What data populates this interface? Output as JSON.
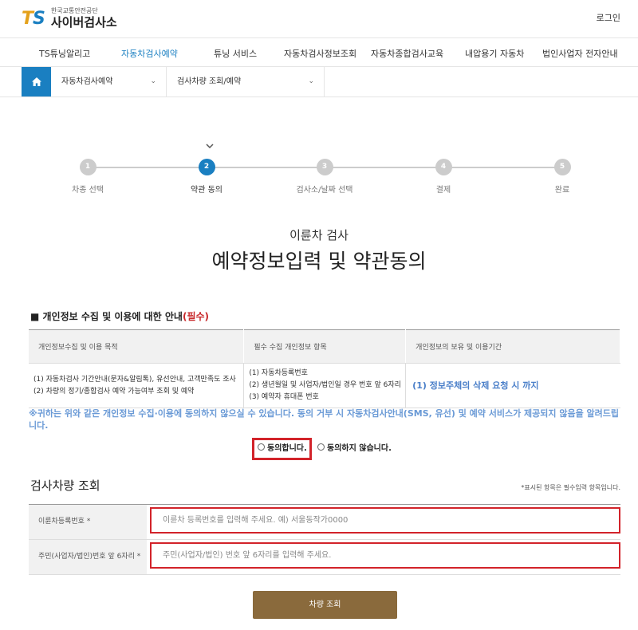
{
  "header": {
    "logo_mark_t": "T",
    "logo_mark_s": "S",
    "logo_small": "한국교통안전공단",
    "logo_big": "사이버검사소",
    "login": "로그인"
  },
  "gnb": [
    {
      "label": "TS튜닝알리고",
      "active": false
    },
    {
      "label": "자동차검사예약",
      "active": true
    },
    {
      "label": "튜닝 서비스",
      "active": false
    },
    {
      "label": "자동차검사정보조회",
      "active": false
    },
    {
      "label": "자동차종합검사교육",
      "active": false
    },
    {
      "label": "내압용기 자동차",
      "active": false
    },
    {
      "label": "법인사업자 전자안내",
      "active": false
    }
  ],
  "breadcrumb": {
    "level1": "자동차검사예약",
    "level2": "검사차량 조회/예약"
  },
  "steps": [
    {
      "num": "1",
      "label": "차종 선택"
    },
    {
      "num": "2",
      "label": "약관 동의"
    },
    {
      "num": "3",
      "label": "검사소/날짜 선택"
    },
    {
      "num": "4",
      "label": "결제"
    },
    {
      "num": "5",
      "label": "완료"
    }
  ],
  "active_step": 2,
  "page": {
    "subtitle": "이륜차 검사",
    "title": "예약정보입력 및 약관동의"
  },
  "privacy": {
    "title_main": "■ 개인정보 수집 및 이용에 대한 안내",
    "title_req": "(필수)",
    "headers": [
      "개인정보수집 및 이용 목적",
      "필수 수집 개인정보 항목",
      "개인정보의 보유 및 이용기간"
    ],
    "purpose": [
      "(1) 자동차검사 기간안내(문자&알림톡), 유선안내, 고객만족도 조사",
      "(2) 차량의 정기/종합검사 예약 가능여부 조회 및 예약"
    ],
    "items": [
      "(1) 자동차등록번호",
      "(2) 생년월일 및 사업자/법인일 경우 번호 앞 6자리",
      "(3) 예약자 휴대폰 번호"
    ],
    "retention": "(1) 정보주체의 삭제 요청 시 까지",
    "notice": "※귀하는 위와 같은 개인정보 수집·이용에 동의하지 않으실 수 있습니다. 동의 거부 시 자동차검사안내(SMS, 유선) 및 예약 서비스가 제공되지 않음을 알려드립니다."
  },
  "consent": {
    "agree": "동의합니다.",
    "disagree": "동의하지 않습니다."
  },
  "query": {
    "title": "검사차량 조회",
    "note": "*표시된 항목은 필수입력 항목입니다.",
    "plate_label": "이륜차등록번호 *",
    "plate_placeholder": "이륜차 등록번호를 입력해 주세요. 예) 서울동작가0000",
    "id_label": "주민(사업자/법인)번호 앞 6자리 *",
    "id_placeholder": "주민(사업자/법인) 번호 앞 6자리를 입력해 주세요.",
    "button": "차량 조회"
  },
  "colors": {
    "accent_blue": "#1a7fc1",
    "highlight_red": "#d2232a",
    "button_brown": "#8a6a3c"
  }
}
